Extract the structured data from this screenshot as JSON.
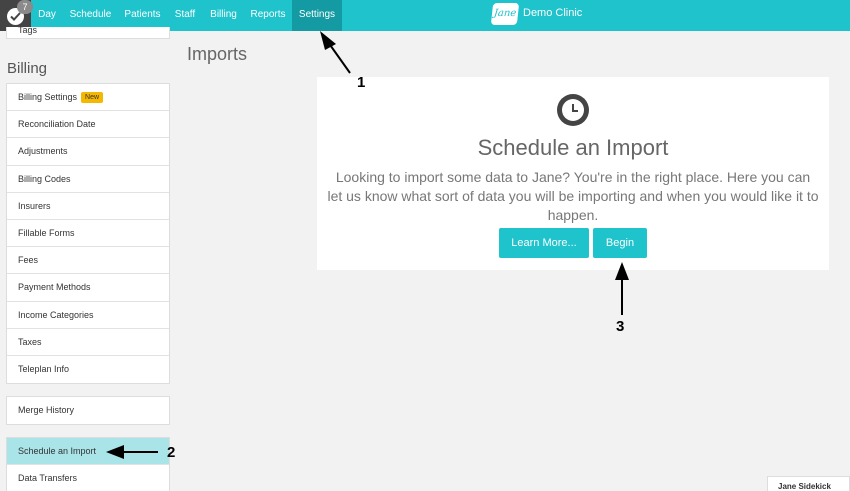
{
  "nav": {
    "tasks_badge": "7",
    "items": [
      "Day",
      "Schedule",
      "Patients",
      "Staff",
      "Billing",
      "Reports",
      "Settings"
    ],
    "active": "Settings",
    "logo_mark": "Jane",
    "clinic_name": "Demo Clinic"
  },
  "sidebar": {
    "partial_item": "Tags",
    "billing_title": "Billing",
    "billing_items": [
      "Billing Settings",
      "Reconciliation Date",
      "Adjustments",
      "Billing Codes",
      "Insurers",
      "Fillable Forms",
      "Fees",
      "Payment Methods",
      "Income Categories",
      "Taxes",
      "Teleplan Info"
    ],
    "new_badge": "New",
    "merge_item": "Merge History",
    "import_items": [
      "Schedule an Import",
      "Data Transfers"
    ]
  },
  "main": {
    "page_title": "Imports",
    "card_title": "Schedule an Import",
    "card_desc": "Looking to import some data to Jane? You're in the right place. Here you can let us know what sort of data you will be importing and when you would like it to happen.",
    "learn_more": "Learn More...",
    "begin": "Begin"
  },
  "user_chip": "Jane Sidekick",
  "annotations": [
    "1",
    "2",
    "3"
  ],
  "colors": {
    "brand": "#1ec3cc",
    "active_nav": "#149aa2",
    "active_sidebar": "#a9e4e8",
    "new_badge": "#f5b800"
  }
}
